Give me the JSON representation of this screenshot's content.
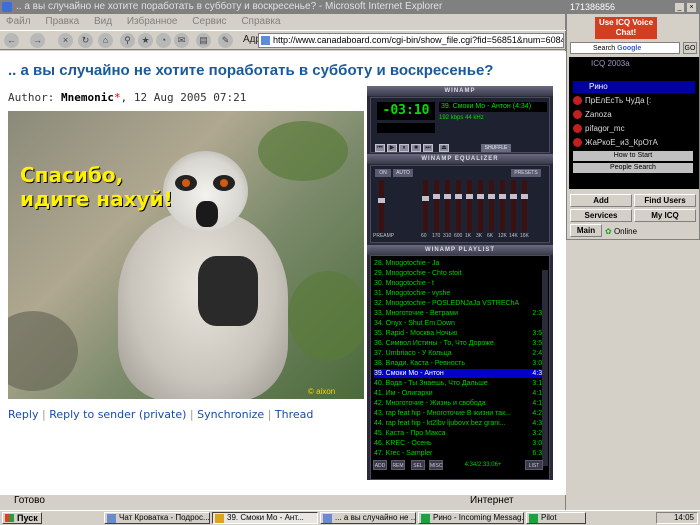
{
  "ie": {
    "title": ".. а вы случайно не хотите поработать в субботу и воскресенье? - Microsoft Internet Explorer",
    "menu": [
      "Файл",
      "Правка",
      "Вид",
      "Избранное",
      "Сервис",
      "Справка"
    ],
    "address_label": "Адрес",
    "address": "http://www.canadaboard.com/cgi-bin/show_file.cgi?fid=56851&num=608467",
    "status": "Готово",
    "zone": "Интернет"
  },
  "page": {
    "title": ".. а вы случайно не хотите поработать в субботу и воскресенье?",
    "author_label": "Author:",
    "author": "Mnemonic",
    "author_star": "*",
    "date": ", 12 Aug 2005 07:21",
    "photo_caption_1": "Спасибо,",
    "photo_caption_2": "идите нахуй!",
    "photo_sign": "© aixon",
    "links": {
      "reply": "Reply",
      "reply_private": "Reply to sender (private)",
      "synchronize": "Synchronize",
      "thread": "Thread",
      "sep": "|"
    }
  },
  "winamp": {
    "title": "WINAMP",
    "time": "-03:10",
    "song": "39. Смоки Мо - Антон (4:34)",
    "kbps": "192",
    "khz": "44",
    "kbps_label": "kbps",
    "khz_label": "kHz",
    "shuffle": "SHUFFLE",
    "eq_title": "WINAMP EQUALIZER",
    "eq_on": "ON",
    "eq_auto": "AUTO",
    "eq_presets": "PRESETS",
    "eq_preamp": "PREAMP",
    "eq_labels": [
      "60",
      "170",
      "310",
      "600",
      "1K",
      "3K",
      "6K",
      "12K",
      "14K",
      "16K"
    ],
    "eq_levels": [
      0.35,
      0.3,
      0.3,
      0.3,
      0.3,
      0.3,
      0.3,
      0.3,
      0.3,
      0.3
    ],
    "playlist_title": "WINAMP PLAYLIST",
    "playlist": [
      {
        "n": "28. Mnogotochie - Ja",
        "t": ""
      },
      {
        "n": "29. Mnogotochie - Chto stoit",
        "t": ""
      },
      {
        "n": "30. Mnogotochie - t",
        "t": ""
      },
      {
        "n": "31. Mnogotochie - vyshe",
        "t": ""
      },
      {
        "n": "32. Mnogotochie - POSLEDNJaJa VSTREChA",
        "t": ""
      },
      {
        "n": "33. Многоточие - Ветрами",
        "t": "2:34"
      },
      {
        "n": "34. Onyx - Shut Em Down",
        "t": ""
      },
      {
        "n": "35. Rapid - Москва Ночью",
        "t": "3:58"
      },
      {
        "n": "36. Символ Истины - То, Что Дороже",
        "t": "3:58"
      },
      {
        "n": "37. Umbriaco - У Кольца",
        "t": "2:48"
      },
      {
        "n": "38. Влади. Каста - Ревность",
        "t": "3:00"
      },
      {
        "n": "39. Смоки Мо - Антон",
        "t": "4:34"
      },
      {
        "n": "40. Вода - Ты Знаешь, Что Дальше",
        "t": "3:18"
      },
      {
        "n": "41. Им - Олигархи",
        "t": "4:14"
      },
      {
        "n": "42. Многоточие - Жизнь и свобода",
        "t": "4:10"
      },
      {
        "n": "43. rap feat hip - Многоточие В жизни так...",
        "t": "4:27"
      },
      {
        "n": "44. rap feat hip - kt2lbv ljubovx bez grani...",
        "t": "4:36"
      },
      {
        "n": "45. Каста - Про Макса",
        "t": "3:28"
      },
      {
        "n": "46. KREC - Осень",
        "t": "3:03"
      },
      {
        "n": "47. Krec - Sampler",
        "t": "6:34"
      }
    ],
    "selected_index": 11,
    "pl_buttons": [
      "ADD",
      "REM",
      "SEL",
      "MISC"
    ],
    "pl_list": "LIST",
    "pl_time": "4:34/2:33:06+"
  },
  "icq": {
    "title": "171386856",
    "voice": "Use ICQ Voice Chat!",
    "search": "Search",
    "google": "Google",
    "go": "GO",
    "list_header": "ICQ 2003a",
    "group": "Рино",
    "contacts": [
      "ПрЕлЕсТь ЧуДа [:",
      "Zanoza",
      "pifagor_mc",
      "ЖаРкоЕ_и3_КрОтА"
    ],
    "how_to_start": "How to Start",
    "people_search": "People Search",
    "buttons": {
      "add": "Add",
      "find_users": "Find Users",
      "services": "Services",
      "my_icq": "My ICQ",
      "main": "Main"
    },
    "status": "Online"
  },
  "taskbar": {
    "start": "Пуск",
    "tasks": [
      "Чат Кроватка - Подрос...",
      "39. Смоки Мо - Ант...",
      "... а вы случайно не ...",
      "Рино - Incoming Messag...",
      "Pilot"
    ],
    "clock": "14:05"
  }
}
